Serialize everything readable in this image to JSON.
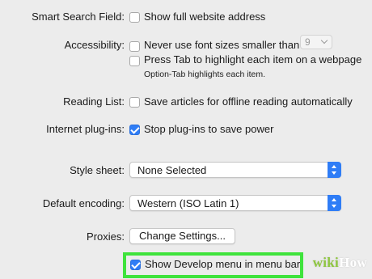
{
  "smart_search": {
    "label": "Smart Search Field:",
    "show_full_address": {
      "label": "Show full website address",
      "checked": false
    }
  },
  "accessibility": {
    "label": "Accessibility:",
    "never_use_small_fonts": {
      "label": "Never use font sizes smaller than",
      "checked": false
    },
    "min_font_size": "9",
    "press_tab": {
      "label": "Press Tab to highlight each item on a webpage",
      "checked": false
    },
    "option_tab_note": "Option-Tab highlights each item."
  },
  "reading_list": {
    "label": "Reading List:",
    "save_offline": {
      "label": "Save articles for offline reading automatically",
      "checked": false
    }
  },
  "plugins": {
    "label": "Internet plug-ins:",
    "stop_plugins": {
      "label": "Stop plug-ins to save power",
      "checked": true
    }
  },
  "style_sheet": {
    "label": "Style sheet:",
    "value": "None Selected"
  },
  "encoding": {
    "label": "Default encoding:",
    "value": "Western (ISO Latin 1)"
  },
  "proxies": {
    "label": "Proxies:",
    "button": "Change Settings..."
  },
  "develop_menu": {
    "label": "Show Develop menu in menu bar",
    "checked": true
  },
  "colors": {
    "accent": "#2f7df6",
    "highlight": "#3fe33c",
    "background": "#ececec"
  },
  "watermark": {
    "part1": "wiki",
    "part2": "How"
  }
}
